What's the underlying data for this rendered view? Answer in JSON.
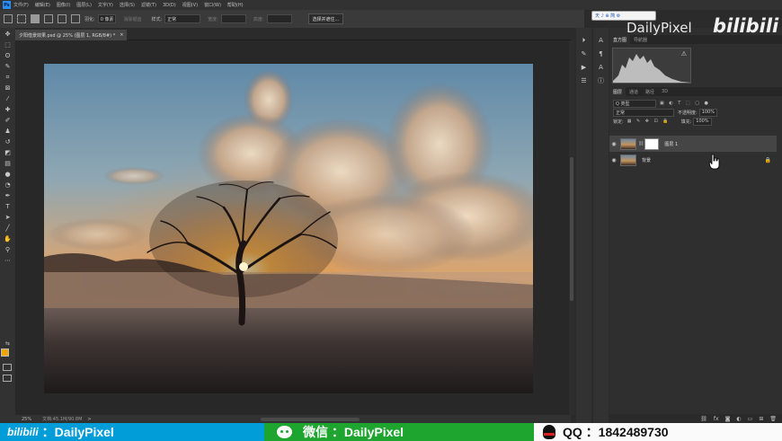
{
  "menubar": {
    "app_icon": "Ps",
    "items": [
      "文件(F)",
      "编辑(E)",
      "图像(I)",
      "图层(L)",
      "文字(Y)",
      "选择(S)",
      "滤镜(T)",
      "3D(D)",
      "视图(V)",
      "窗口(W)",
      "帮助(H)"
    ]
  },
  "options_bar": {
    "feather_label": "羽化:",
    "feather_value": "0 像素",
    "antialias_label": "消除锯齿",
    "style_label": "样式:",
    "style_value": "正常",
    "width_label": "宽度:",
    "height_label": "高度:",
    "select_mask_button": "选择并遮住..."
  },
  "document": {
    "tab_title": "夕阳借景效果.psd @ 25% (图层 1, RGB/8#) *",
    "close_glyph": "×",
    "zoom": "25%",
    "doc_info": "文档:45.1M/90.8M",
    "status_arrow": ">"
  },
  "tools": [
    {
      "name": "move-tool-icon",
      "glyph": "✥"
    },
    {
      "name": "marquee-tool-icon",
      "glyph": "⬚"
    },
    {
      "name": "lasso-tool-icon",
      "glyph": "ʘ"
    },
    {
      "name": "quick-select-tool-icon",
      "glyph": "✎"
    },
    {
      "name": "crop-tool-icon",
      "glyph": "⌗"
    },
    {
      "name": "frame-tool-icon",
      "glyph": "⊠"
    },
    {
      "name": "eyedropper-tool-icon",
      "glyph": "⁄"
    },
    {
      "name": "healing-brush-icon",
      "glyph": "✚"
    },
    {
      "name": "brush-tool-icon",
      "glyph": "✐"
    },
    {
      "name": "clone-stamp-icon",
      "glyph": "♟"
    },
    {
      "name": "history-brush-icon",
      "glyph": "↺"
    },
    {
      "name": "eraser-tool-icon",
      "glyph": "◩"
    },
    {
      "name": "gradient-tool-icon",
      "glyph": "▤"
    },
    {
      "name": "blur-tool-icon",
      "glyph": "●"
    },
    {
      "name": "dodge-tool-icon",
      "glyph": "◔"
    },
    {
      "name": "pen-tool-icon",
      "glyph": "✒"
    },
    {
      "name": "type-tool-icon",
      "glyph": "T"
    },
    {
      "name": "path-select-icon",
      "glyph": "➤"
    },
    {
      "name": "line-tool-icon",
      "glyph": "╱"
    },
    {
      "name": "hand-tool-icon",
      "glyph": "✋"
    },
    {
      "name": "zoom-tool-icon",
      "glyph": "⚲"
    },
    {
      "name": "more-tools-icon",
      "glyph": "⋯"
    }
  ],
  "colors": {
    "foreground": "#f0a500",
    "background": "#111111",
    "footer_blue": "#009dd8",
    "footer_green": "#1ea52f"
  },
  "right_panel": {
    "histogram_tabs": [
      "直方图",
      "导航器"
    ],
    "histogram_warning": "⚠",
    "layer_tabs": [
      "图层",
      "通道",
      "路径",
      "3D"
    ],
    "filter_label": "Q 类型",
    "blend_mode": "正常",
    "opacity_label": "不透明度:",
    "opacity_value": "100%",
    "lock_label": "锁定:",
    "fill_label": "填充:",
    "fill_value": "100%",
    "layers": [
      {
        "name": "图层 1",
        "has_mask": true,
        "selected": true
      },
      {
        "name": "背景",
        "has_mask": false,
        "selected": false
      }
    ],
    "footer_icons": [
      "link-icon",
      "fx-icon",
      "mask-icon",
      "adjustment-icon",
      "group-icon",
      "new-layer-icon",
      "trash-icon"
    ]
  },
  "overlay": {
    "watermark_text": "DailyPixel",
    "bilibili_logo": "bilibili",
    "badge_text": "天 ♪ ⊕ 简 ⚙"
  },
  "footer": {
    "bili_logo": "bilibili",
    "bili_text": "：DailyPixel",
    "wechat_text": "微信 ：DailyPixel",
    "qq_text": "QQ ：1842489730"
  }
}
